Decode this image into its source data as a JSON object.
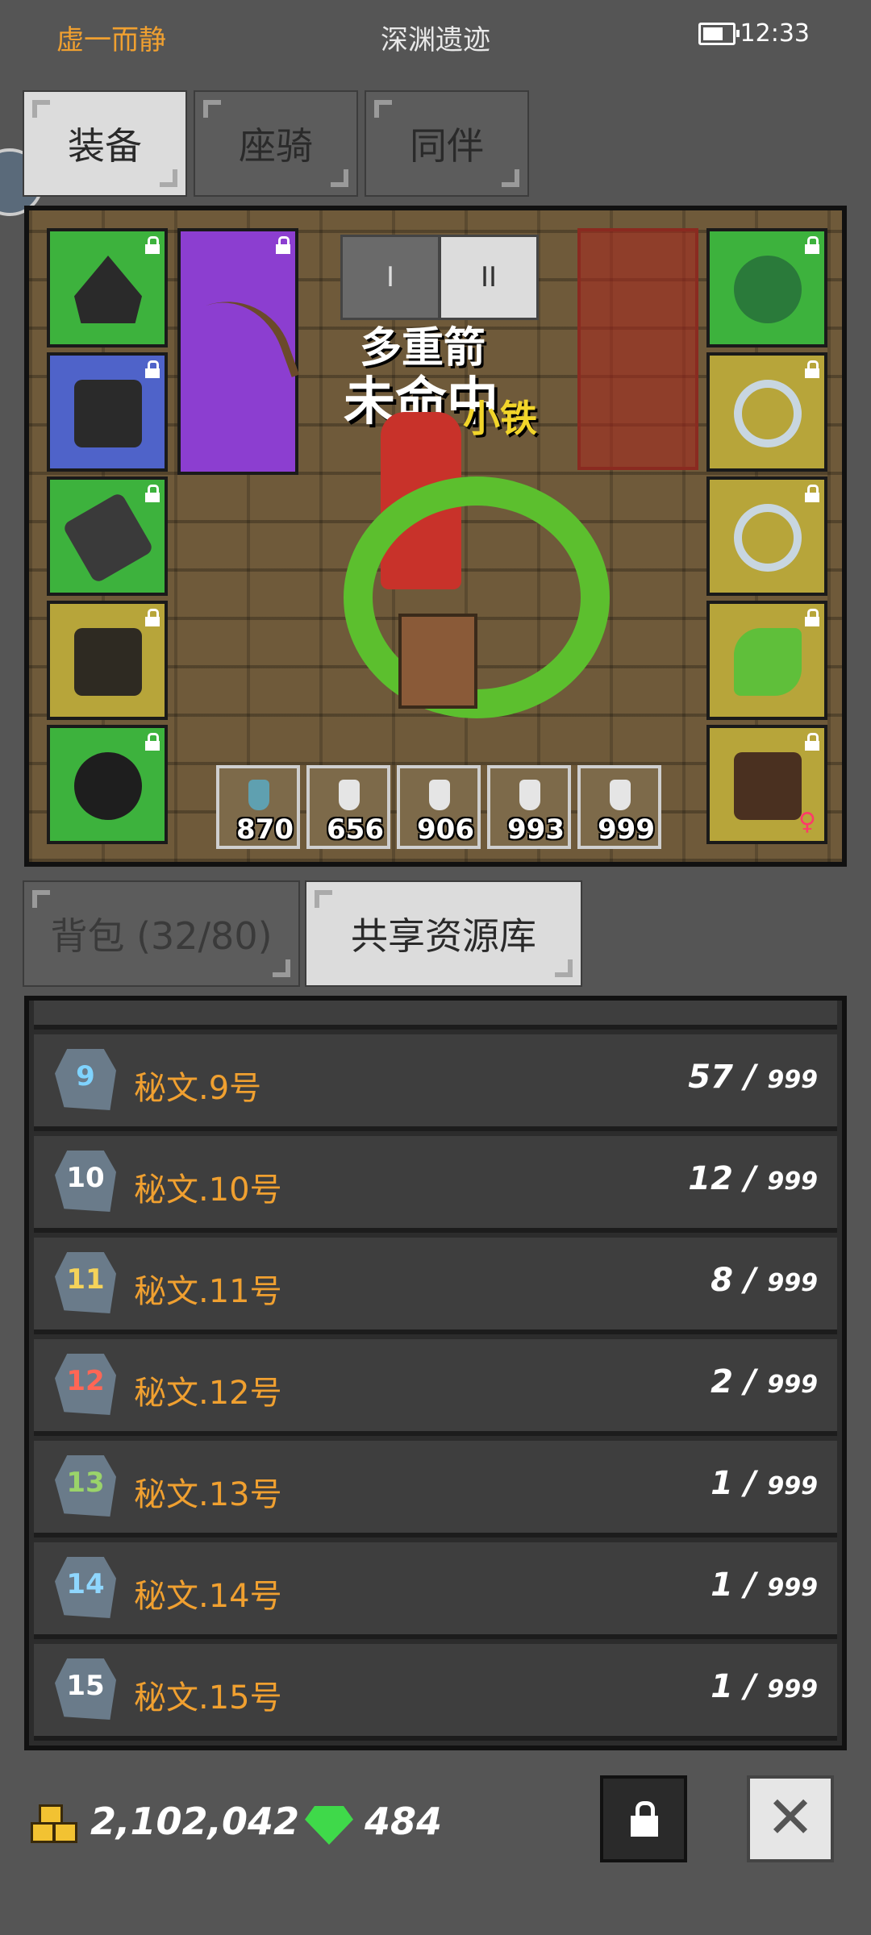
{
  "status": {
    "player_name": "虚一而静",
    "location": "深渊遗迹",
    "time": "12:33"
  },
  "top_tabs": [
    {
      "label": "装备",
      "active": true
    },
    {
      "label": "座骑",
      "active": false
    },
    {
      "label": "同伴",
      "active": false
    }
  ],
  "equipment_view": {
    "page_buttons": [
      "I",
      "II"
    ],
    "overlay_texts": [
      "多重箭",
      "未命中",
      "小铁"
    ],
    "potions": [
      {
        "icon": "fish-potion-icon",
        "count": "870"
      },
      {
        "icon": "health-potion-icon",
        "count": "656"
      },
      {
        "icon": "mana-potion-icon",
        "count": "906"
      },
      {
        "icon": "potion-icon",
        "count": "993"
      },
      {
        "icon": "potion-icon",
        "count": "999"
      }
    ]
  },
  "resource_tabs": [
    {
      "label": "背包 (32/80)",
      "active": false
    },
    {
      "label": "共享资源库",
      "active": true
    }
  ],
  "resources": [
    {
      "icon_text": "9",
      "name": "秘文.9号",
      "count": "57 / ",
      "max": "999",
      "color": "#7fd3ff"
    },
    {
      "icon_text": "10",
      "name": "秘文.10号",
      "count": "12 / ",
      "max": "999",
      "color": "#ffffff"
    },
    {
      "icon_text": "11",
      "name": "秘文.11号",
      "count": "8 / ",
      "max": "999",
      "color": "#f5d35a"
    },
    {
      "icon_text": "12",
      "name": "秘文.12号",
      "count": "2 / ",
      "max": "999",
      "color": "#ff6655"
    },
    {
      "icon_text": "13",
      "name": "秘文.13号",
      "count": "1 / ",
      "max": "999",
      "color": "#9ad36a"
    },
    {
      "icon_text": "14",
      "name": "秘文.14号",
      "count": "1 / ",
      "max": "999",
      "color": "#8fd7ff"
    },
    {
      "icon_text": "15",
      "name": "秘文.15号",
      "count": "1 / ",
      "max": "999",
      "color": "#ffffff"
    }
  ],
  "currency": {
    "gold": "2,102,042",
    "gems": "484"
  },
  "colors": {
    "accent_orange": "#f0a030",
    "slot_green": "#3db23d",
    "slot_yellow": "#b7a53a",
    "slot_purple": "#8c3ed0",
    "slot_blue": "#4f63c9"
  }
}
